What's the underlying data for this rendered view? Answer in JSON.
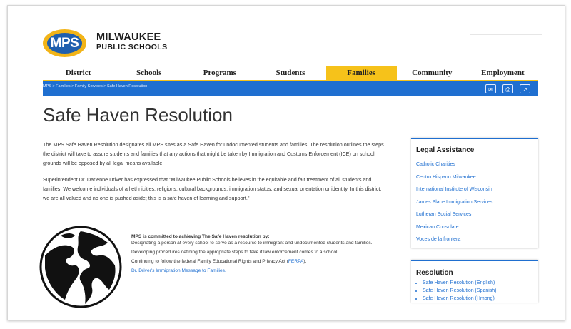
{
  "header": {
    "logo_letters": "MPS",
    "org_line1": "MILWAUKEE",
    "org_line2": "PUBLIC SCHOOLS"
  },
  "nav": {
    "items": [
      "District",
      "Schools",
      "Programs",
      "Students",
      "Families",
      "Community",
      "Employment"
    ],
    "active": "Families"
  },
  "breadcrumb": "MPS > Families > Family Services > Safe Haven Resolution",
  "toolbar": {
    "icons": [
      "email-icon",
      "print-icon",
      "external-link-icon"
    ]
  },
  "page": {
    "title": "Safe Haven Resolution",
    "paragraphs": [
      "The MPS Safe Haven Resolution designates all MPS sites as a Safe Haven for undocumented students and families. The resolution outlines the steps the district will take to assure students and families that any actions that might be taken by Immigration and Customs Enforcement (ICE) on school grounds will be opposed by all legal means available.",
      "Superintendent Dr. Darienne Driver has expressed that \"Milwaukee Public Schools believes in the equitable and fair treatment of all students and families. We welcome individuals of all ethnicities, religions, cultural backgrounds, immigration status, and sexual orientation or identity. In this district, we are all valued and no one is pushed aside; this is a safe haven of learning and support.\""
    ],
    "commitment": {
      "heading": "MPS is committed to achieving The Safe Haven resolution by:",
      "line1": "Designating a person at every school to serve as a resource to immigrant and undocumented students and families.",
      "line2": "Developing procedures defining the appropriate steps to take if law enforcement comes to a school.",
      "line3_prefix": "Continuing to follow the federal Family Educational Rights and Privacy Act (",
      "line3_link": "FERPA",
      "line3_suffix": ").",
      "video_link": "Dr. Driver's Immigration Message to Families."
    }
  },
  "sidebar": {
    "legal": {
      "title": "Legal Assistance",
      "links": [
        "Catholic Charities",
        "Centro Hispano Milwaukee",
        "International Institute of Wisconsin",
        "James Place Immigration Services",
        "Lutheran Social Services",
        "Mexican Consulate",
        "Voces de la frontera"
      ]
    },
    "resolution": {
      "title": "Resolution",
      "links": [
        "Safe Haven Resolution (English)",
        "Safe Haven Resolution (Spanish)",
        "Safe Haven Resolution (Hmong)"
      ]
    }
  },
  "colors": {
    "accent_yellow": "#f6c21a",
    "accent_blue": "#1f6fd0",
    "logo_blue": "#1f5fae",
    "logo_gold": "#f2b418"
  }
}
